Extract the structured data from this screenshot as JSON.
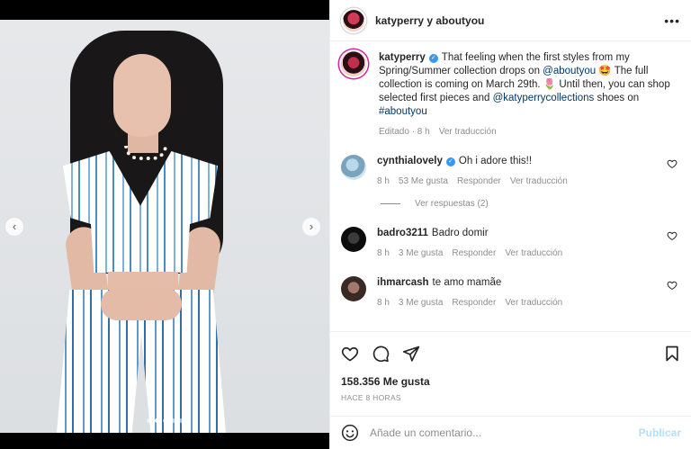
{
  "header": {
    "title": "katyperry y aboutyou",
    "more_icon": "more-horizontal-icon"
  },
  "media": {
    "prev_icon": "chevron-left-icon",
    "next_icon": "chevron-right-icon",
    "slide_count": 5,
    "active_slide": 2
  },
  "caption": {
    "username": "katyperry",
    "verified": true,
    "text_1": "That feeling when the first styles from my Spring/Summer collection drops on ",
    "mention_1": "@aboutyou",
    "emoji_1": "🤩",
    "text_2": " The full collection is coming on March 29th. ",
    "emoji_2": "🌷",
    "text_3": " Until then, you can shop selected first pieces and ",
    "mention_2": "@katyperrycollections",
    "text_4": " shoes on ",
    "hashtag": "#aboutyou",
    "meta_edited": "Editado · 8 h",
    "meta_translate": "Ver traducción"
  },
  "comments": [
    {
      "username": "cynthialovely",
      "text": "Oh i adore this!!",
      "time": "8 h",
      "likes": "53 Me gusta",
      "reply": "Responder",
      "translate": "Ver traducción"
    },
    {
      "username": "badro3211",
      "text": "Badro domir",
      "time": "8 h",
      "likes": "3 Me gusta",
      "reply": "Responder",
      "translate": "Ver traducción"
    },
    {
      "username": "ihmarcash",
      "text": "te amo mamãe",
      "time": "8 h",
      "likes": "3 Me gusta",
      "reply": "Responder",
      "translate": "Ver traducción"
    }
  ],
  "view_replies": "Ver respuestas (2)",
  "actions": {
    "likes_count": "158.356 Me gusta",
    "posted_time": "HACE 8 HORAS"
  },
  "add_comment": {
    "placeholder": "Añade un comentario...",
    "publish_label": "Publicar"
  },
  "colors": {
    "link": "#00376b",
    "muted": "#8e8e8e",
    "verified": "#3897f0",
    "publish_disabled": "#b2dffc"
  }
}
